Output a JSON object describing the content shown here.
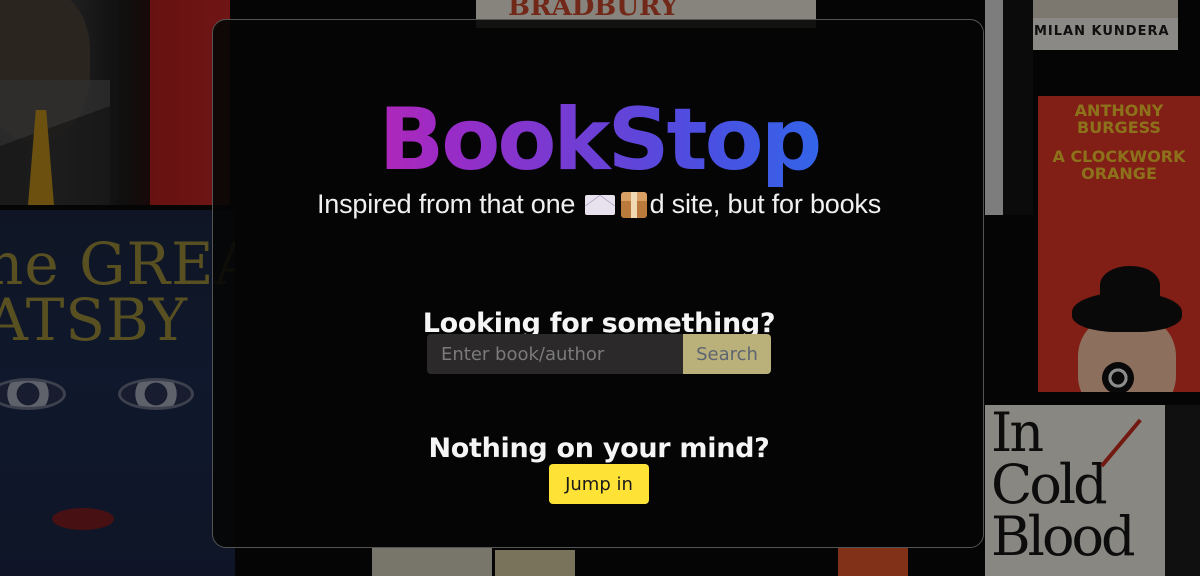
{
  "app": {
    "title": "BookStop",
    "tagline_before": "Inspired from that one",
    "tagline_after": "d site, but for books",
    "tagline_icons": [
      "envelope-icon",
      "package-icon"
    ],
    "gradient_colors": [
      "#e01f95",
      "#9b2bc6",
      "#4e4de0",
      "#1182f4"
    ]
  },
  "search": {
    "heading": "Looking for something?",
    "placeholder": "Enter book/author",
    "value": "",
    "button_label": "Search"
  },
  "random": {
    "heading": "Nothing on your mind?",
    "button_label": "Jump in"
  },
  "background_covers": {
    "gatsby_title": "he GREAT\nATSBY",
    "kundera_author": "MILAN KUNDERA",
    "clockwork_author": "ANTHONY\nBURGESS",
    "clockwork_title": "A CLOCKWORK\nORANGE",
    "cold_blood_title": "In\nCold\nBlood",
    "bradbury_fragment": "BRADBURY"
  },
  "colors": {
    "search_button": "#b9b07a",
    "jump_button": "#ffe236",
    "input_background": "#2b2929"
  }
}
